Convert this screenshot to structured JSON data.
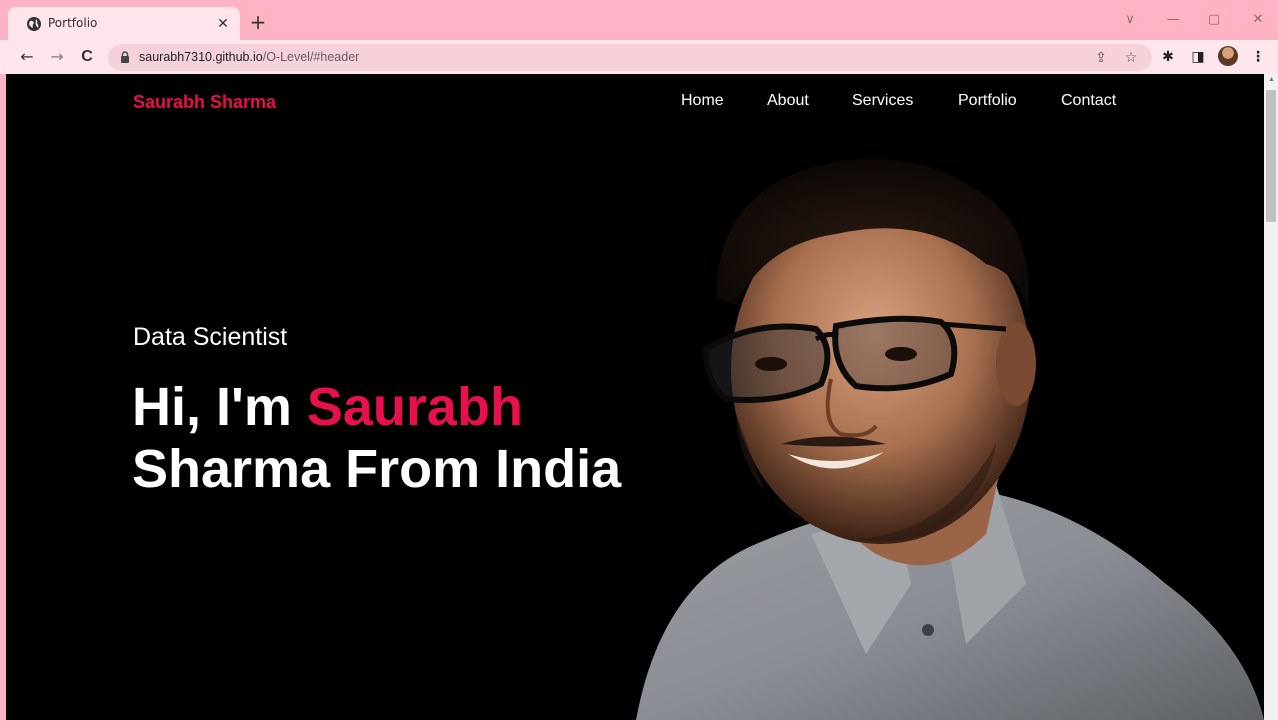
{
  "browser": {
    "tab_title": "Portfolio",
    "tab_close": "✕",
    "new_tab": "+",
    "url_host": "saurabh7310.github.io",
    "url_path": "/O-Level/#header",
    "back": "←",
    "forward": "→",
    "reload": "C",
    "window": {
      "dropdown": "∨",
      "minimize": "—",
      "restore": "▢",
      "close": "✕"
    }
  },
  "page": {
    "logo": "Saurabh Sharma",
    "nav": [
      "Home",
      "About",
      "Services",
      "Portfolio",
      "Contact"
    ],
    "subtitle": "Data Scientist",
    "headline": {
      "prefix": "Hi, I'm ",
      "accent": "Saurabh",
      "line2": "Sharma From India"
    }
  },
  "colors": {
    "accent": "#e8104c",
    "background": "#000000",
    "chrome_tabstrip": "#ffb3c4",
    "chrome_toolbar": "#ffe6ec"
  },
  "icons": {
    "favicon": "globe-icon",
    "lock": "lock-icon",
    "share": "share-icon",
    "bookmark": "star-icon",
    "extensions": "puzzle-icon",
    "sidepanel": "side-panel-icon",
    "menu": "kebab-menu-icon"
  }
}
